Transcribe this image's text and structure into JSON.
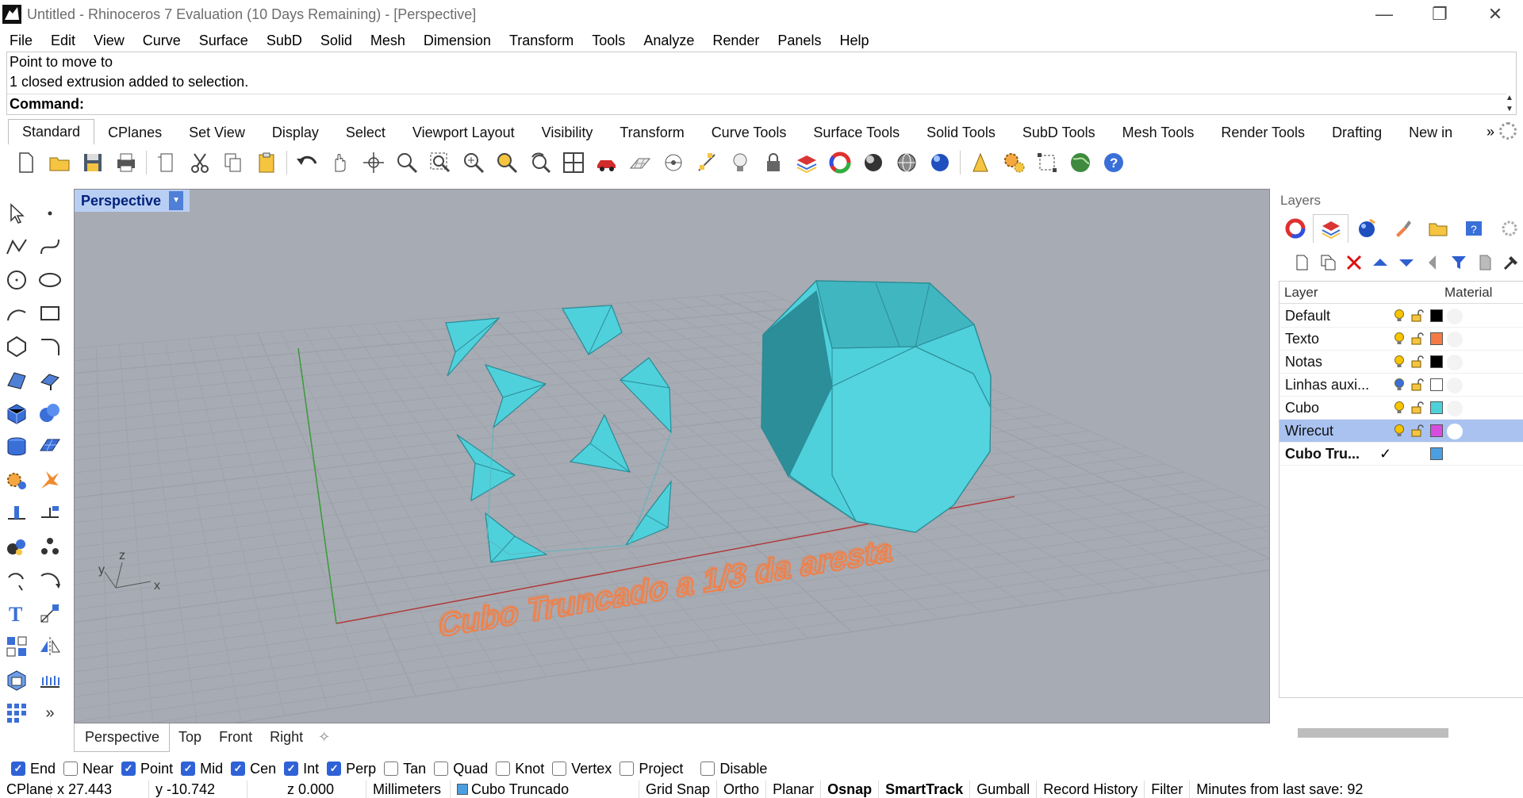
{
  "window": {
    "title": "Untitled - Rhinoceros 7 Evaluation (10 Days Remaining) - [Perspective]",
    "buttons": [
      "minimize",
      "restore",
      "close"
    ]
  },
  "menu": [
    "File",
    "Edit",
    "View",
    "Curve",
    "Surface",
    "SubD",
    "Solid",
    "Mesh",
    "Dimension",
    "Transform",
    "Tools",
    "Analyze",
    "Render",
    "Panels",
    "Help"
  ],
  "command": {
    "history": [
      "Point to move to",
      "1 closed extrusion added to selection."
    ],
    "prompt": "Command:"
  },
  "toolbar_tabs": [
    "Standard",
    "CPlanes",
    "Set View",
    "Display",
    "Select",
    "Viewport Layout",
    "Visibility",
    "Transform",
    "Curve Tools",
    "Surface Tools",
    "Solid Tools",
    "SubD Tools",
    "Mesh Tools",
    "Render Tools",
    "Drafting",
    "New in"
  ],
  "toolbar_tabs_more": "»",
  "viewport": {
    "label": "Perspective",
    "text3d": "Cubo Truncado a 1/3 da aresta",
    "axis_labels": {
      "z": "z",
      "y": "y",
      "x": "x"
    },
    "colors": {
      "background": "#a7abb3",
      "grid": "#9ca0a8",
      "solid": "#4fd1dc",
      "edge": "#2b8c96",
      "text3d": "#f0804a",
      "x_axis": "#b0393b",
      "y_axis": "#3a9a3a"
    }
  },
  "viewport_tabs": [
    "Perspective",
    "Top",
    "Front",
    "Right"
  ],
  "layers": {
    "title": "Layers",
    "header": {
      "layer": "Layer",
      "material": "Material"
    },
    "rows": [
      {
        "name": "Default",
        "color": "#000000",
        "bulb": "#f6c400",
        "current": false,
        "selected": false
      },
      {
        "name": "Texto",
        "color": "#f47a45",
        "bulb": "#f6c400",
        "current": false,
        "selected": false
      },
      {
        "name": "Notas",
        "color": "#000000",
        "bulb": "#f6c400",
        "current": false,
        "selected": false
      },
      {
        "name": "Linhas auxi...",
        "color": "#ffffff",
        "bulb": "#3a6fd8",
        "current": false,
        "selected": false
      },
      {
        "name": "Cubo",
        "color": "#4fd1dc",
        "bulb": "#f6c400",
        "current": false,
        "selected": false
      },
      {
        "name": "Wirecut",
        "color": "#d64de0",
        "bulb": "#f6c400",
        "current": false,
        "selected": true
      },
      {
        "name": "Cubo Tru...",
        "color": "#4b9fe1",
        "bulb": "",
        "current": true,
        "selected": false
      }
    ],
    "current_mark": "✓"
  },
  "osnaps": [
    {
      "label": "End",
      "checked": true
    },
    {
      "label": "Near",
      "checked": false
    },
    {
      "label": "Point",
      "checked": true
    },
    {
      "label": "Mid",
      "checked": true
    },
    {
      "label": "Cen",
      "checked": true
    },
    {
      "label": "Int",
      "checked": true
    },
    {
      "label": "Perp",
      "checked": true
    },
    {
      "label": "Tan",
      "checked": false
    },
    {
      "label": "Quad",
      "checked": false
    },
    {
      "label": "Knot",
      "checked": false
    },
    {
      "label": "Vertex",
      "checked": false
    },
    {
      "label": "Project",
      "checked": false
    },
    {
      "label": "Disable",
      "checked": false
    }
  ],
  "status": {
    "cplane": "CPlane",
    "x": "x 27.443",
    "y": "y -10.742",
    "z": "z 0.000",
    "units": "Millimeters",
    "layer": "Cubo Truncado",
    "layer_color": "#4b9fe1",
    "toggles": [
      "Grid Snap",
      "Ortho",
      "Planar",
      "Osnap",
      "SmartTrack",
      "Gumball",
      "Record History",
      "Filter"
    ],
    "bold_toggles": [
      "Osnap",
      "SmartTrack"
    ],
    "save_info": "Minutes from last save: 92"
  }
}
